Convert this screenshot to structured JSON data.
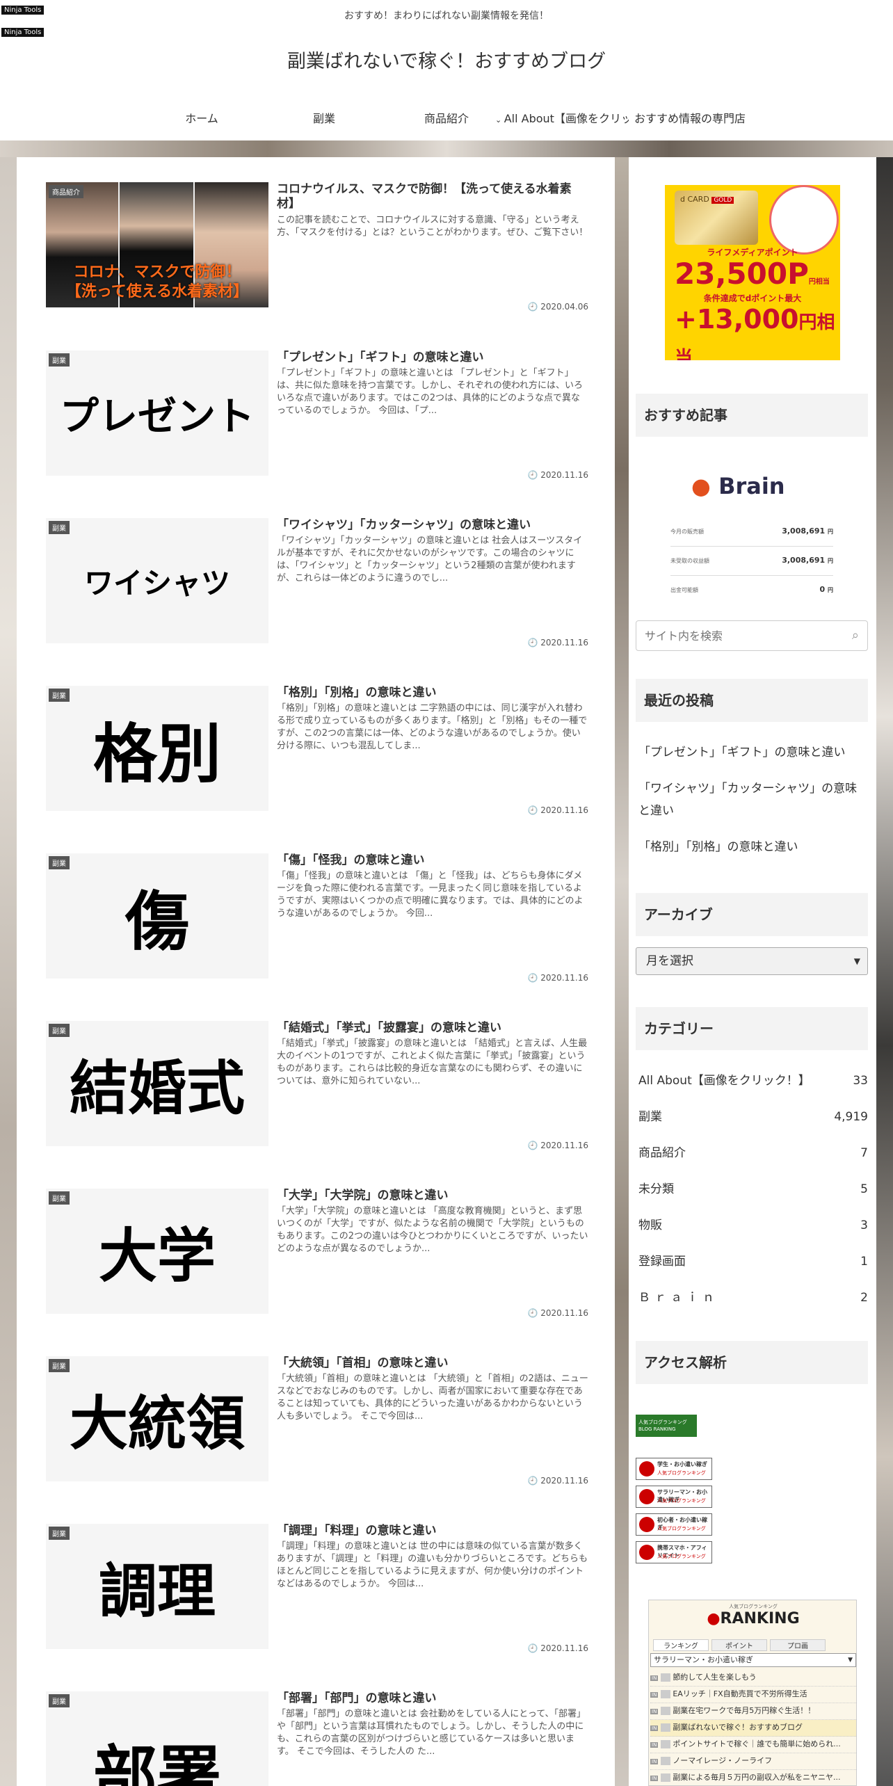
{
  "ninja_tools": [
    "Ninja Tools",
    "Ninja Tools"
  ],
  "header": {
    "tagline": "おすすめ！まわりにばれない副業情報を発信！",
    "site_title": "副業ばれないで稼ぐ！おすすめブログ"
  },
  "nav": {
    "items": [
      "ホーム",
      "副業",
      "商品紹介",
      "All About【画像をクリック！】",
      "おすすめ情報の専門店"
    ]
  },
  "entries": [
    {
      "category": "商品紹介",
      "title": "コロナウイルス、マスクで防御！【洗って使える水着素材】",
      "snippet": "この記事を読むことで、コロナウイルスに対する意識、「守る」という考え方、「マスクを付ける」とは？ということがわかります。ぜひ、ご覧下さい！",
      "date": "2020.04.06",
      "thumb_caption": "コロナ、マスクで防御！\n【洗って使える水着素材】"
    },
    {
      "category": "副業",
      "title": "「プレゼント」「ギフト」の意味と違い",
      "snippet": "「プレゼント」「ギフト」の意味と違いとは 「プレゼント」と「ギフト」は、共に似た意味を持つ言葉です。しかし、それぞれの使われ方には、いろいろな点で違いがあります。ではこの2つは、具体的にどのような点で異なっているのでしょうか。 今回は、「プ...",
      "date": "2020.11.16",
      "thumb_word": "プレゼント"
    },
    {
      "category": "副業",
      "title": "「ワイシャツ」「カッターシャツ」の意味と違い",
      "snippet": "「ワイシャツ」「カッターシャツ」の意味と違いとは 社会人はスーツスタイルが基本ですが、それに欠かせないのがシャツです。この場合のシャツには、「ワイシャツ」と「カッターシャツ」という2種類の言葉が使われますが、これらは一体どのように違うのでし...",
      "date": "2020.11.16",
      "thumb_word": "ワイシャツ"
    },
    {
      "category": "副業",
      "title": "「格別」「別格」の意味と違い",
      "snippet": "「格別」「別格」の意味と違いとは 二字熟語の中には、同じ漢字が入れ替わる形で成り立っているものが多くあります。「格別」と「別格」もその一種ですが、この2つの言葉には一体、どのような違いがあるのでしょうか。使い分ける際に、いつも混乱してしま...",
      "date": "2020.11.16",
      "thumb_word": "格別"
    },
    {
      "category": "副業",
      "title": "「傷」「怪我」の意味と違い",
      "snippet": "「傷」「怪我」の意味と違いとは 「傷」と「怪我」は、どちらも身体にダメージを負った際に使われる言葉です。一見まったく同じ意味を指しているようですが、実際はいくつかの点で明確に異なります。では、具体的にどのような違いがあるのでしょうか。 今回...",
      "date": "2020.11.16",
      "thumb_word": "傷"
    },
    {
      "category": "副業",
      "title": "「結婚式」「挙式」「披露宴」の意味と違い",
      "snippet": "「結婚式」「挙式」「披露宴」の意味と違いとは 「結婚式」と言えば、人生最大のイベントの1つですが、これとよく似た言葉に「挙式」「披露宴」というものがあります。これらは比較的身近な言葉なのにも関わらず、その違いについては、意外に知られていない...",
      "date": "2020.11.16",
      "thumb_word": "結婚式"
    },
    {
      "category": "副業",
      "title": "「大学」「大学院」の意味と違い",
      "snippet": "「大学」「大学院」の意味と違いとは 「高度な教育機関」というと、まず思いつくのが「大学」ですが、似たような名前の機関で「大学院」というものもあります。この2つの違いは今ひとつわかりにくいところですが、いったいどのような点が異なるのでしょうか...",
      "date": "2020.11.16",
      "thumb_word": "大学"
    },
    {
      "category": "副業",
      "title": "「大統領」「首相」の意味と違い",
      "snippet": "「大統領」「首相」の意味と違いとは 「大統領」と「首相」の2語は、ニュースなどでおなじみのものです。しかし、両者が国家において重要な存在であることは知っていても、具体的にどういった違いがあるかわからないという人も多いでしょう。 そこで今回は...",
      "date": "2020.11.16",
      "thumb_word": "大統領"
    },
    {
      "category": "副業",
      "title": "「調理」「料理」の意味と違い",
      "snippet": "「調理」「料理」の意味と違いとは 世の中には意味の似ている言葉が数多くありますが、「調理」と「料理」の違いも分かりづらいところです。どちらもほとんど同じことを指しているように見えますが、何か使い分けのポイントなどはあるのでしょうか。 今回は...",
      "date": "2020.11.16",
      "thumb_word": "調理"
    },
    {
      "category": "副業",
      "title": "「部署」「部門」の意味と違い",
      "snippet": "「部署」「部門」の意味と違いとは 会社勤めをしている人にとって、「部署」や「部門」という言葉は耳慣れたものでしょう。しかし、そうした人の中にも、これらの言葉の区別がつけづらいと感じているケースは多いと思います。 そこで今回は、そうした人の た...",
      "date": "",
      "thumb_word": "部署"
    }
  ],
  "sidebar": {
    "ad": {
      "brand": "d CARD",
      "badge": "GOLD",
      "line1": "ライフメディアポイント",
      "amount1": "23,500",
      "unit1": "P",
      "yen_label": "円相当",
      "line2": "条件達成でdポイント最大",
      "amount2": "+13,000",
      "unit2": "円相当"
    },
    "recommend_title": "おすすめ記事",
    "brain": {
      "logo": "Brain",
      "rows": [
        {
          "label": "今月の販売額",
          "value": "3,008,691",
          "unit": "円"
        },
        {
          "label": "未受取の収益額",
          "value": "3,008,691",
          "unit": "円"
        },
        {
          "label": "出金可能額",
          "value": "0",
          "unit": "円"
        }
      ]
    },
    "search_placeholder": "サイト内を検索",
    "recent_title": "最近の投稿",
    "recent": [
      "「プレゼント」「ギフト」の意味と違い",
      "「ワイシャツ」「カッターシャツ」の意味と違い",
      "「格別」「別格」の意味と違い"
    ],
    "archive_title": "アーカイブ",
    "archive_select": "月を選択",
    "category_title": "カテゴリー",
    "categories": [
      {
        "name": "All About【画像をクリック！】",
        "count": "33"
      },
      {
        "name": "副業",
        "count": "4,919"
      },
      {
        "name": "商品紹介",
        "count": "7"
      },
      {
        "name": "未分類",
        "count": "5"
      },
      {
        "name": "物販",
        "count": "3"
      },
      {
        "name": "登録画面",
        "count": "1"
      },
      {
        "name": "Ｂｒａｉｎ",
        "count": "2"
      }
    ],
    "access_title": "アクセス解析",
    "blog_ranking_badge": {
      "line1": "人気ブログランキング",
      "line2": "BLOG RANKING"
    },
    "ranking_buttons": [
      {
        "line1": "学生・お小遣い稼ぎ",
        "line2": "人気ブログランキング"
      },
      {
        "line1": "サラリーマン・お小遣い稼ぎ",
        "line2": "人気ブログランキング"
      },
      {
        "line1": "初心者・お小遣い稼ぎ",
        "line2": "人気ブログランキング"
      },
      {
        "line1": "携帯スマホ・アフィリエイト",
        "line2": "人気ブログランキング"
      }
    ],
    "ranking_widget": {
      "top_label": "人気ブログランキング",
      "logo": "RANKING",
      "tabs": [
        "ランキング",
        "ポイント",
        "プロ画"
      ],
      "select": "サラリーマン・お小遣い稼ぎ",
      "items": [
        "節約して人生を楽しもう",
        "EAリッチ｜FX自動売買で不労所得生活",
        "副業在宅ワークで毎月5万円稼ぐ生活！！",
        "副業ばれないで稼ぐ！おすすめブログ",
        "ポイントサイトで稼ぐ｜誰でも簡単に始められ...",
        "ノーマイレージ・ノーライフ",
        "副業による毎月５万円の副収入が私をニヤニヤ..."
      ]
    }
  }
}
